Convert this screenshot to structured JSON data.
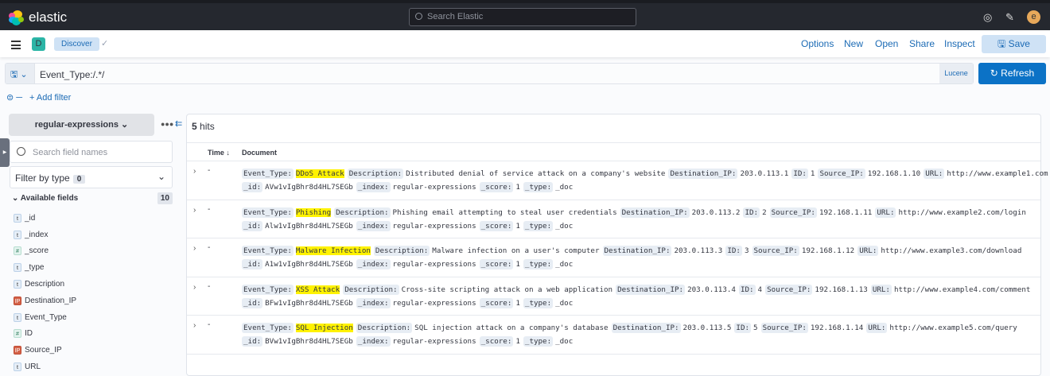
{
  "header": {
    "brand": "elastic",
    "search_placeholder": "Search Elastic",
    "avatar": "e"
  },
  "nav": {
    "app_badge": "D",
    "breadcrumb": "Discover",
    "menu": [
      "Options",
      "New",
      "Open",
      "Share",
      "Inspect"
    ],
    "save": "Save"
  },
  "query": {
    "value": "Event_Type:/.*/",
    "language": "Lucene",
    "refresh": "Refresh",
    "add_filter": "+ Add filter"
  },
  "sidebar": {
    "index_pattern": "regular-expressions",
    "search_placeholder": "Search field names",
    "filter_by_type": "Filter by type",
    "filter_count": "0",
    "available_label": "Available fields",
    "available_count": "10",
    "fields": [
      {
        "type": "t",
        "name": "_id"
      },
      {
        "type": "t",
        "name": "_index"
      },
      {
        "type": "#",
        "name": "_score"
      },
      {
        "type": "t",
        "name": "_type"
      },
      {
        "type": "t",
        "name": "Description"
      },
      {
        "type": "IP",
        "name": "Destination_IP"
      },
      {
        "type": "t",
        "name": "Event_Type"
      },
      {
        "type": "#",
        "name": "ID"
      },
      {
        "type": "IP",
        "name": "Source_IP"
      },
      {
        "type": "t",
        "name": "URL"
      }
    ]
  },
  "results": {
    "hits_count": "5",
    "hits_label": "hits",
    "col_time": "Time ↓",
    "col_document": "Document",
    "rows": [
      {
        "time": "-",
        "line1": [
          [
            "Event_Type:",
            "DDoS Attack"
          ],
          [
            "Description:",
            "Distributed denial of service attack on a company's website"
          ],
          [
            "Destination_IP:",
            "203.0.113.1"
          ],
          [
            "ID:",
            "1"
          ],
          [
            "Source_IP:",
            "192.168.1.10"
          ],
          [
            "URL:",
            "http://www.example1.com"
          ]
        ],
        "line2": [
          [
            "_id:",
            "AVw1vIgBhr8d4HL7SEGb"
          ],
          [
            "_index:",
            "regular-expressions"
          ],
          [
            "_score:",
            "1"
          ],
          [
            "_type:",
            "_doc"
          ]
        ]
      },
      {
        "time": "-",
        "line1": [
          [
            "Event_Type:",
            "Phishing"
          ],
          [
            "Description:",
            "Phishing email attempting to steal user credentials"
          ],
          [
            "Destination_IP:",
            "203.0.113.2"
          ],
          [
            "ID:",
            "2"
          ],
          [
            "Source_IP:",
            "192.168.1.11"
          ],
          [
            "URL:",
            "http://www.example2.com/login"
          ]
        ],
        "line2": [
          [
            "_id:",
            "Alw1vIgBhr8d4HL7SEGb"
          ],
          [
            "_index:",
            "regular-expressions"
          ],
          [
            "_score:",
            "1"
          ],
          [
            "_type:",
            "_doc"
          ]
        ]
      },
      {
        "time": "-",
        "line1": [
          [
            "Event_Type:",
            "Malware Infection"
          ],
          [
            "Description:",
            "Malware infection on a user's computer"
          ],
          [
            "Destination_IP:",
            "203.0.113.3"
          ],
          [
            "ID:",
            "3"
          ],
          [
            "Source_IP:",
            "192.168.1.12"
          ],
          [
            "URL:",
            "http://www.example3.com/download"
          ]
        ],
        "line2": [
          [
            "_id:",
            "A1w1vIgBhr8d4HL7SEGb"
          ],
          [
            "_index:",
            "regular-expressions"
          ],
          [
            "_score:",
            "1"
          ],
          [
            "_type:",
            "_doc"
          ]
        ]
      },
      {
        "time": "-",
        "line1": [
          [
            "Event_Type:",
            "XSS Attack"
          ],
          [
            "Description:",
            "Cross-site scripting attack on a web application"
          ],
          [
            "Destination_IP:",
            "203.0.113.4"
          ],
          [
            "ID:",
            "4"
          ],
          [
            "Source_IP:",
            "192.168.1.13"
          ],
          [
            "URL:",
            "http://www.example4.com/comment"
          ]
        ],
        "line2": [
          [
            "_id:",
            "BFw1vIgBhr8d4HL7SEGb"
          ],
          [
            "_index:",
            "regular-expressions"
          ],
          [
            "_score:",
            "1"
          ],
          [
            "_type:",
            "_doc"
          ]
        ]
      },
      {
        "time": "-",
        "line1": [
          [
            "Event_Type:",
            "SQL Injection"
          ],
          [
            "Description:",
            "SQL injection attack on a company's database"
          ],
          [
            "Destination_IP:",
            "203.0.113.5"
          ],
          [
            "ID:",
            "5"
          ],
          [
            "Source_IP:",
            "192.168.1.14"
          ],
          [
            "URL:",
            "http://www.example5.com/query"
          ]
        ],
        "line2": [
          [
            "_id:",
            "BVw1vIgBhr8d4HL7SEGb"
          ],
          [
            "_index:",
            "regular-expressions"
          ],
          [
            "_score:",
            "1"
          ],
          [
            "_type:",
            "_doc"
          ]
        ]
      }
    ]
  },
  "colors": {
    "header_bg": "#25282f",
    "accent": "#0b72c6",
    "highlight": "#fff200"
  }
}
